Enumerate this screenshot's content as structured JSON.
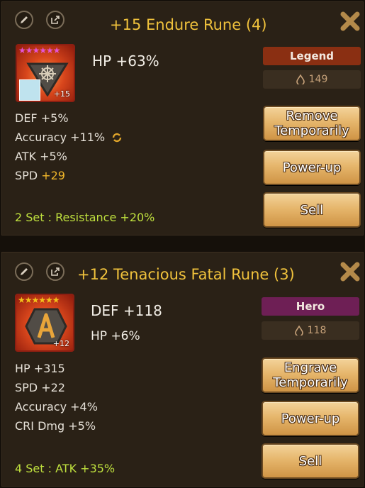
{
  "runes": [
    {
      "title": "+15 Endure Rune (4)",
      "stars": 6,
      "star_color": "#e455d6",
      "level_label": "+15",
      "main_stat": "HP +63%",
      "sub_main": "",
      "grade": "Legend",
      "grade_color": "#8a2f12",
      "price": "149",
      "substats": [
        {
          "name": "DEF",
          "value": "+5%"
        },
        {
          "name": "Accuracy",
          "value": "+11%"
        },
        {
          "name": "ATK",
          "value": "+5%"
        },
        {
          "name": "SPD",
          "value": "+29"
        }
      ],
      "set_bonus": "2 Set : Resistance +20%",
      "buttons": {
        "remove": [
          "Remove",
          "Temporarily"
        ],
        "powerup": "Power-up",
        "sell": "Sell"
      }
    },
    {
      "title": "+12 Tenacious Fatal Rune (3)",
      "stars": 6,
      "star_color": "#f3c21b",
      "level_label": "+12",
      "main_stat": "DEF +118",
      "sub_main": "HP +6%",
      "grade": "Hero",
      "grade_color": "#6e1f55",
      "price": "118",
      "substats": [
        {
          "name": "HP",
          "value": "+315"
        },
        {
          "name": "SPD",
          "value": "+22"
        },
        {
          "name": "Accuracy",
          "value": "+4%"
        },
        {
          "name": "CRI Dmg",
          "value": "+5%"
        }
      ],
      "set_bonus": "4 Set : ATK +35%",
      "buttons": {
        "engrave": [
          "Engrave",
          "Temporarily"
        ],
        "powerup": "Power-up",
        "sell": "Sell"
      }
    }
  ],
  "icons": {
    "edit": "pencil-icon",
    "share": "share-icon",
    "close": "close-icon",
    "mana": "mana-drop-icon",
    "refresh": "reroll-icon"
  },
  "star_glyph": "★★★★★★"
}
